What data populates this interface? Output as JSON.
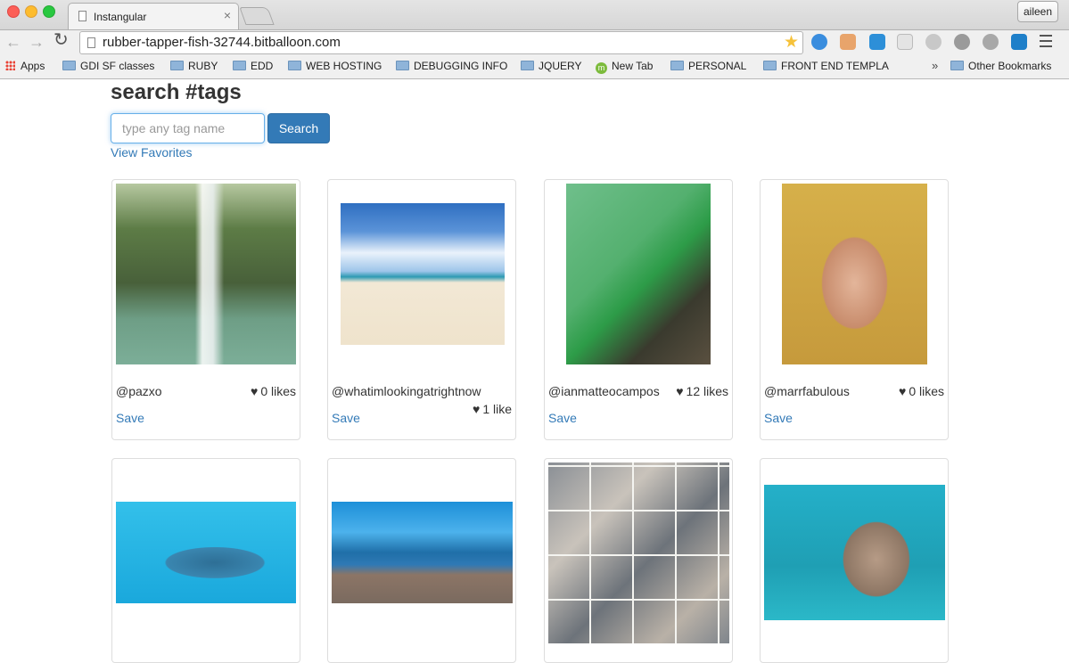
{
  "browser": {
    "tab_title": "Instangular",
    "tab_close": "×",
    "user_name": "aileen",
    "url": "rubber-tapper-fish-32744.bitballoon.com",
    "nav": {
      "back": "←",
      "forward": "→",
      "reload": "↻"
    },
    "star": "★",
    "bookmarks": [
      {
        "label": "Apps",
        "icon": "apps-grid-icon"
      },
      {
        "label": "GDI SF classes",
        "icon": "folder-icon"
      },
      {
        "label": "RUBY",
        "icon": "folder-icon"
      },
      {
        "label": "EDD",
        "icon": "folder-icon"
      },
      {
        "label": "WEB HOSTING",
        "icon": "folder-icon"
      },
      {
        "label": "DEBUGGING INFO",
        "icon": "folder-icon"
      },
      {
        "label": "JQUERY",
        "icon": "folder-icon"
      },
      {
        "label": "New Tab",
        "icon": "m-icon"
      },
      {
        "label": "PERSONAL",
        "icon": "folder-icon"
      },
      {
        "label": "FRONT END TEMPLA",
        "icon": "folder-icon"
      },
      {
        "label": "Other Bookmarks",
        "icon": "folder-icon"
      }
    ],
    "overflow_chevron": "»"
  },
  "page": {
    "title": "search #tags",
    "search": {
      "placeholder": "type any tag name",
      "value": "",
      "button": "Search"
    },
    "favorites_link": "View Favorites",
    "heart": "♥",
    "save_label": "Save",
    "cards": [
      {
        "user": "@pazxo",
        "likes": "0 likes",
        "photo": "waterfall"
      },
      {
        "user": "@whatimlookingatrightnow",
        "likes": "1 like",
        "photo": "beach"
      },
      {
        "user": "@ianmatteocampos",
        "likes": "12 likes",
        "photo": "green-shirt"
      },
      {
        "user": "@marrfabulous",
        "likes": "0 likes",
        "photo": "bunny-filter"
      },
      {
        "photo": "whale-shark"
      },
      {
        "photo": "rocky-shore"
      },
      {
        "photo": "collage"
      },
      {
        "photo": "underwater"
      }
    ]
  },
  "colors": {
    "link": "#337ab7",
    "button": "#337ab7",
    "focus_ring": "#66afe9"
  }
}
